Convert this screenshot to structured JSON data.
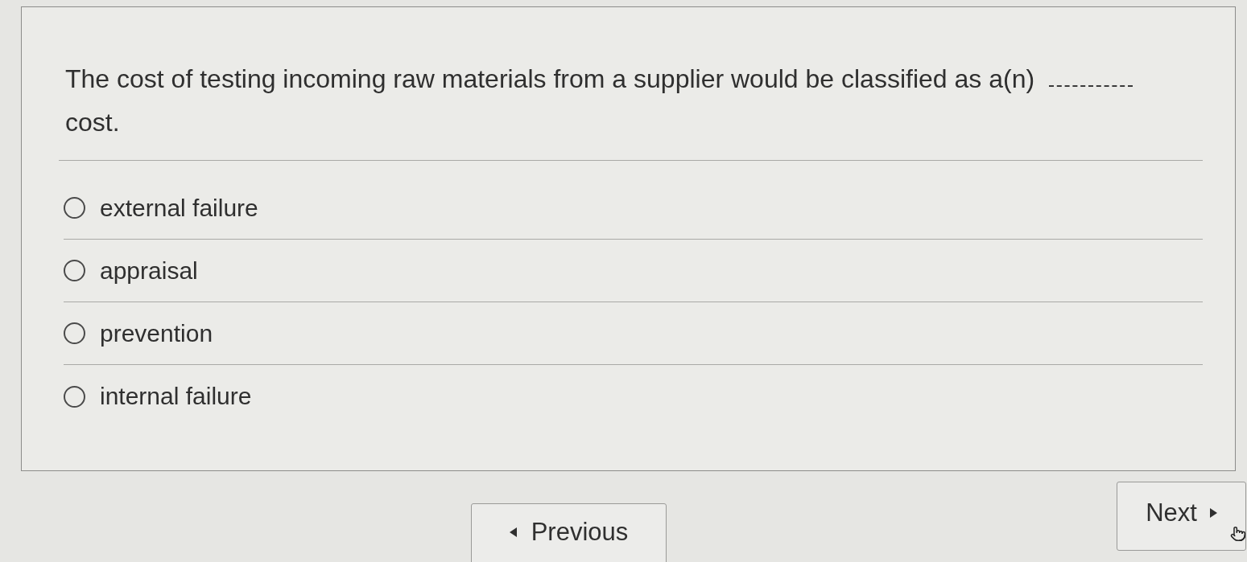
{
  "question": {
    "text_before": "The cost of testing incoming raw materials from a supplier would be classified as a(n)",
    "text_after": "cost."
  },
  "options": [
    {
      "label": "external failure",
      "selected": false
    },
    {
      "label": "appraisal",
      "selected": false
    },
    {
      "label": "prevention",
      "selected": false
    },
    {
      "label": "internal failure",
      "selected": false
    }
  ],
  "buttons": {
    "previous": {
      "label": "Previous"
    },
    "next": {
      "label": "Next"
    }
  }
}
